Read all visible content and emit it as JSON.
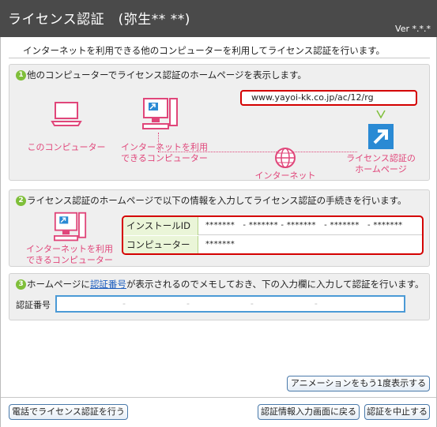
{
  "window": {
    "title": "ライセンス認証　(弥生** **)",
    "version": "Ver *.*.*"
  },
  "intro_text": "インターネットを利用できる他のコンピューターを利用してライセンス認証を行います。",
  "step1": {
    "number": "1",
    "heading": "他のコンピューターでライセンス認証のホームページを表示します。",
    "url": "www.yayoi-kk.co.jp/ac/12/rg",
    "label_this_computer": "このコンピューター",
    "label_internet_computer_1": "インターネットを利用",
    "label_internet_computer_2": "できるコンピューター",
    "label_internet": "インターネット",
    "label_homepage_1": "ライセンス認証の",
    "label_homepage_2": "ホームページ"
  },
  "step2": {
    "number": "2",
    "heading": "ライセンス認証のホームページで以下の情報を入力してライセンス認証の手続きを行います。",
    "label_internet_computer_1": "インターネットを利用",
    "label_internet_computer_2": "できるコンピューター",
    "install_id_label": "インストールID",
    "install_id_value": "*******　- ******* - *******　- *******　- *******",
    "computer_name_label": "コンピューター名",
    "computer_name_value": "*******"
  },
  "step3": {
    "number": "3",
    "heading_pre": "ホームページに",
    "heading_link": "認証番号",
    "heading_post": "が表示されるのでメモしておき、下の入力欄に入力して認証を行います。",
    "auth_label": "認証番号",
    "auth_value": "　　　　　　　-　　　　　　　-　　　　　　　-　　　　　　　-"
  },
  "buttons": {
    "replay_animation": "アニメーションをもう1度表示する",
    "phone_activation": "電話でライセンス認証を行う",
    "back_to_input": "認証情報入力画面に戻る",
    "cancel_activation": "認証を中止する"
  },
  "colors": {
    "accent_pink": "#e0467a",
    "highlight_red": "#d40000",
    "step_green": "#7fbf3a",
    "link_blue": "#1f5fbf"
  }
}
